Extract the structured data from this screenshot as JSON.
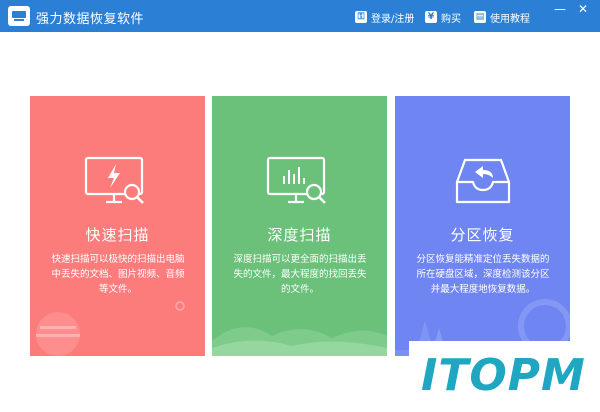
{
  "window": {
    "title": "强力数据恢复软件",
    "minimize": "—",
    "close": "✕"
  },
  "toolbar": {
    "login": {
      "label": "登录/注册",
      "icon": "key-icon"
    },
    "buy": {
      "label": "购买",
      "icon": "yen-icon"
    },
    "tutorial": {
      "label": "使用教程",
      "icon": "book-icon"
    }
  },
  "cards": [
    {
      "title": "快速扫描",
      "description": "快速扫描可以极快的扫描出电脑中丢失的文档、图片视频、音频等文件。",
      "color": "#fc7c7c",
      "icon": "monitor-lightning-search-icon"
    },
    {
      "title": "深度扫描",
      "description": "深度扫描可以更全面的扫描出丢失的文件，最大程度的找回丢失的文件。",
      "color": "#6bc07a",
      "icon": "monitor-chart-search-icon"
    },
    {
      "title": "分区恢复",
      "description": "分区恢复能精准定位丢失数据的所在硬盘区域，深度检测该分区并最大程度地恢复数据。",
      "color": "#6f86f2",
      "icon": "tray-restore-icon"
    }
  ],
  "watermark": {
    "text": "ITOPM"
  },
  "colors": {
    "titlebar": "#2b80d6",
    "watermark": "#1fa7c2"
  }
}
